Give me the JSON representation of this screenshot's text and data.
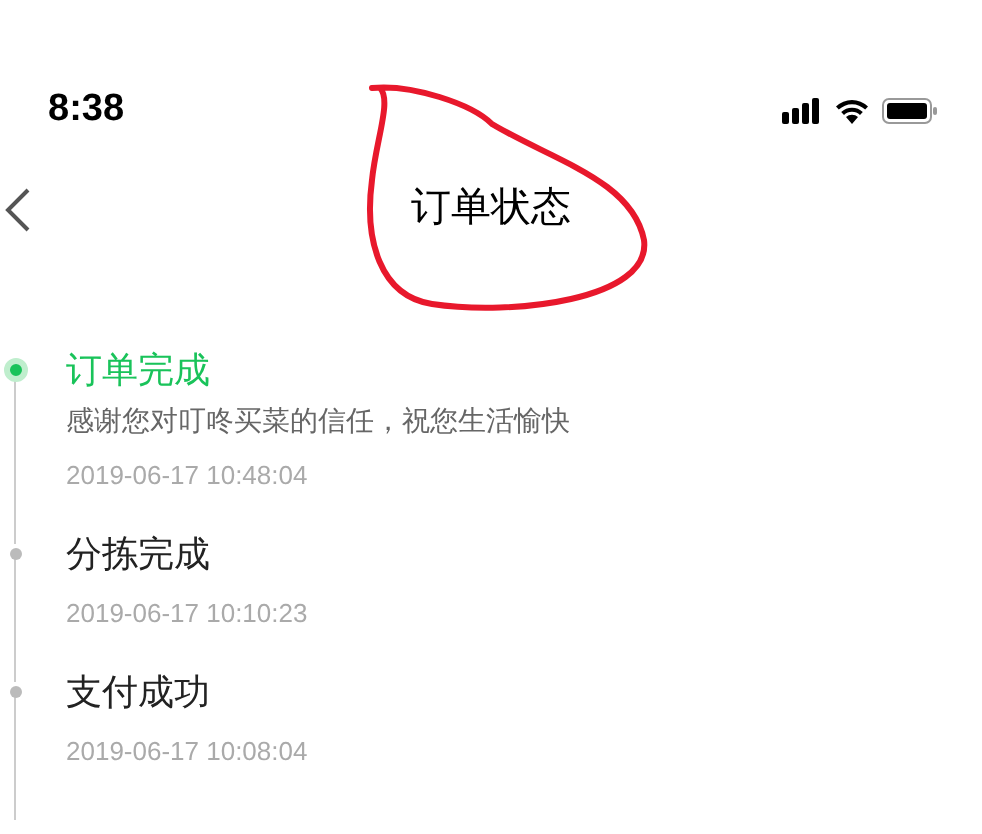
{
  "status_bar": {
    "time": "8:38"
  },
  "nav": {
    "title": "订单状态"
  },
  "timeline": [
    {
      "title": "订单完成",
      "active": true,
      "description": "感谢您对叮咚买菜的信任，祝您生活愉快",
      "time": "2019-06-17 10:48:04"
    },
    {
      "title": "分拣完成",
      "active": false,
      "time": "2019-06-17 10:10:23"
    },
    {
      "title": "支付成功",
      "active": false,
      "time": "2019-06-17 10:08:04"
    }
  ]
}
